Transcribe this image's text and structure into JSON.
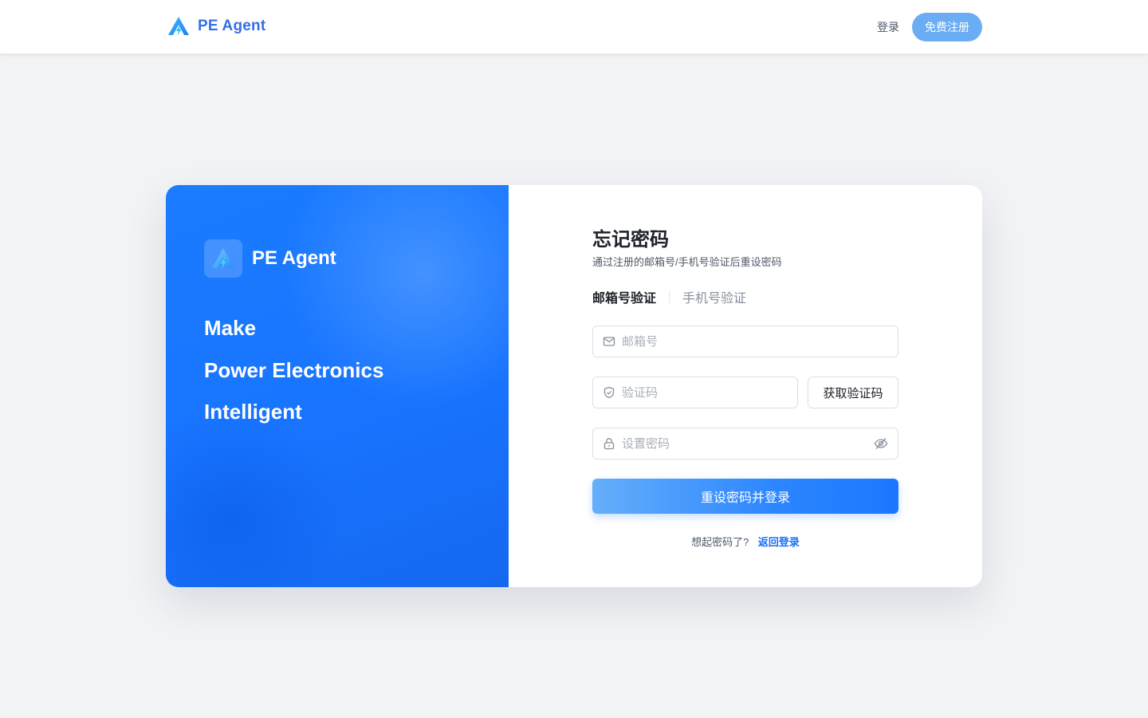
{
  "header": {
    "brand_name": "PE Agent",
    "login_label": "登录",
    "register_label": "免费注册"
  },
  "hero": {
    "title": "PE Agent",
    "lines": [
      "Make",
      "Power Electronics",
      "Intelligent"
    ]
  },
  "form": {
    "title": "忘记密码",
    "subtitle": "通过注册的邮箱号/手机号验证后重设密码",
    "tabs": [
      {
        "label": "邮箱号验证",
        "active": true
      },
      {
        "label": "手机号验证",
        "active": false
      }
    ],
    "email": {
      "placeholder": "邮箱号",
      "value": ""
    },
    "code": {
      "placeholder": "验证码",
      "value": ""
    },
    "get_code_label": "获取验证码",
    "password": {
      "placeholder": "设置密码",
      "value": ""
    },
    "submit_label": "重设密码并登录",
    "footer_text": "想起密码了?",
    "back_link": "返回登录"
  },
  "icons": {
    "brand_logo": "pe-agent-logo-icon",
    "email": "mail-icon",
    "code": "shield-icon",
    "password": "lock-icon",
    "visibility": "eye-off-icon"
  },
  "colors": {
    "brand_blue": "#1874ff",
    "link_blue": "#1b6ff5",
    "register_button": "#6aadf5",
    "page_background": "#f2f3f5"
  }
}
